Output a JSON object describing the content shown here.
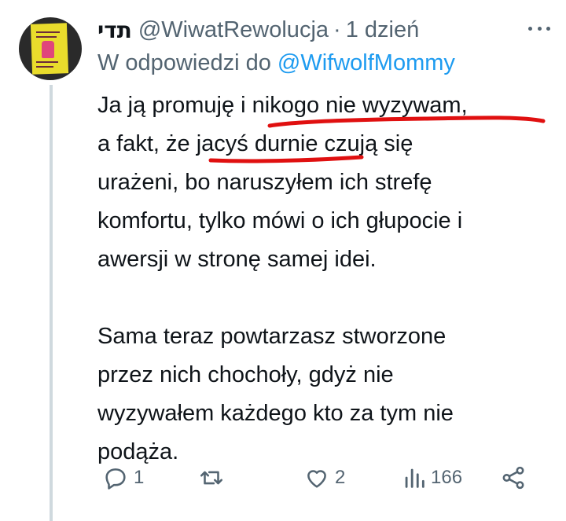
{
  "tweet": {
    "display_name": "תדי",
    "handle": "@WiwatRewolucja",
    "separator": "·",
    "time": "1 dzień",
    "reply_to_prefix": "W odpowiedzi do",
    "reply_to_handle": "@WifwolfMommy",
    "paragraphs": [
      [
        "Ja ją promuję i nikogo nie wyzywam,",
        "a fakt, że jacyś durnie czują się",
        "urażeni, bo naruszyłem ich strefę",
        "komfortu, tylko mówi o ich głupocie i",
        "awersji w stronę samej idei."
      ],
      [
        "Sama teraz powtarzasz stworzone",
        "przez nich chochoły, gdyż nie",
        "wyzywałem każdego kto za tym nie",
        "podąża."
      ]
    ]
  },
  "actions": {
    "reply_count": "1",
    "retweet_count": "",
    "like_count": "2",
    "view_count": "166"
  },
  "colors": {
    "annotation_underline": "#e01010",
    "link": "#1d9bf0",
    "muted": "#536471"
  },
  "icons": [
    "reply-icon",
    "retweet-icon",
    "like-icon",
    "views-icon",
    "share-icon",
    "more-icon"
  ]
}
